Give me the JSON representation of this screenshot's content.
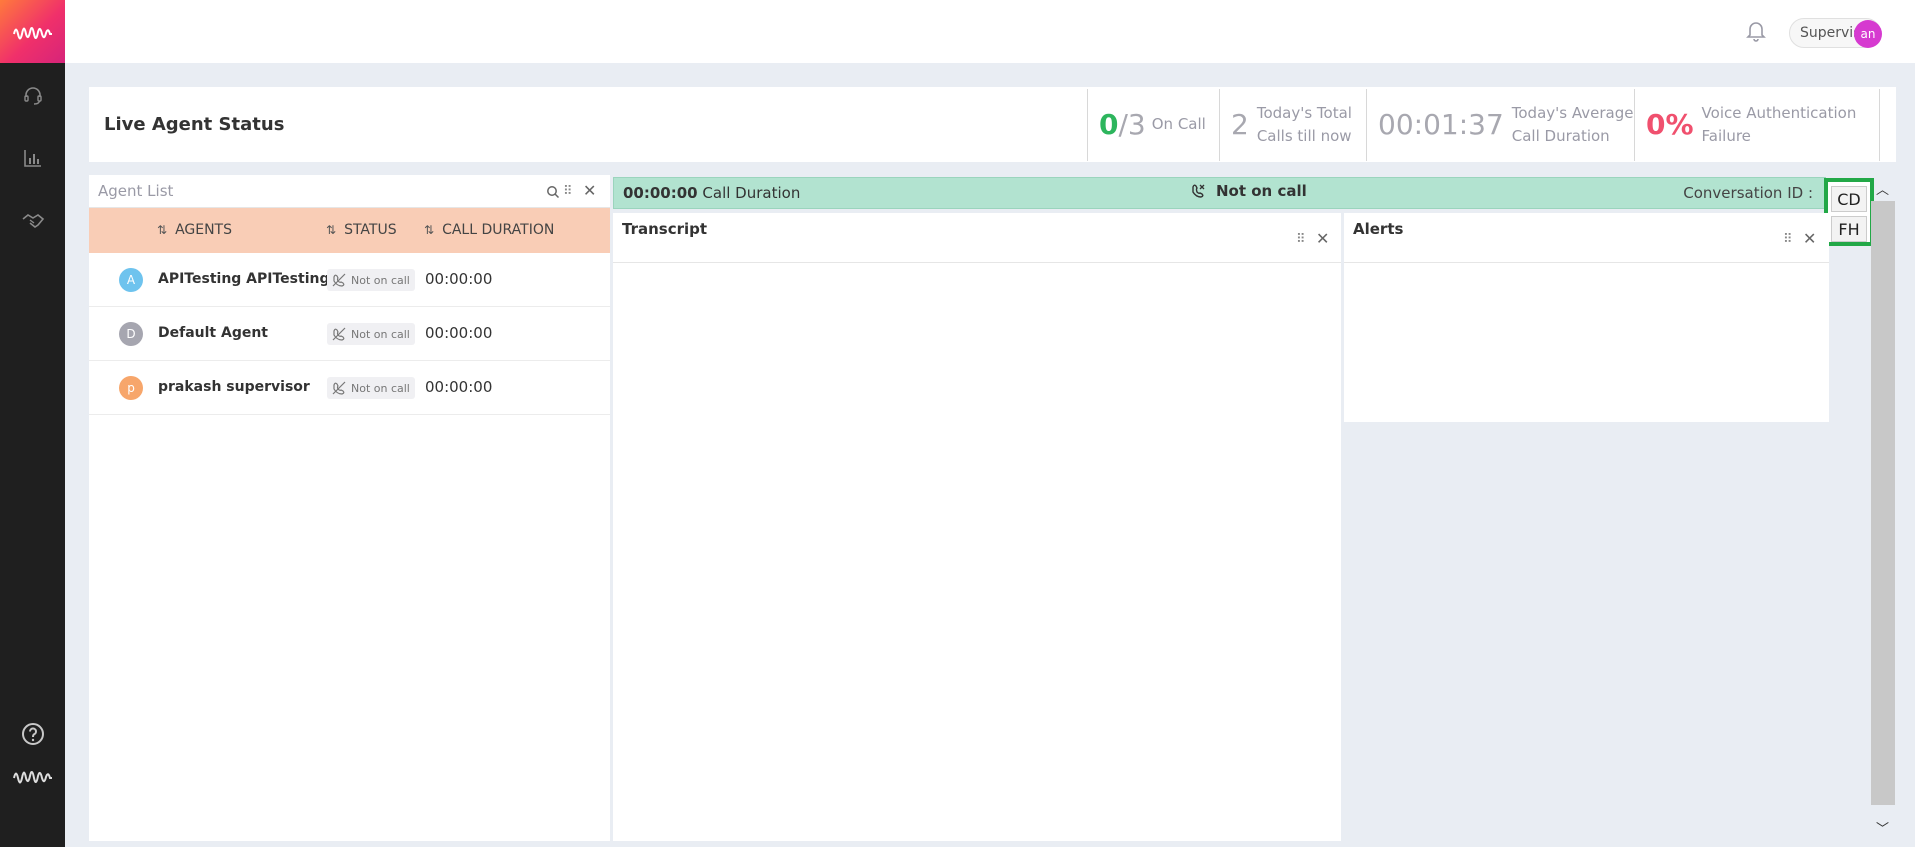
{
  "sidebar": {
    "items": [
      {
        "icon": "headset-icon"
      },
      {
        "icon": "bar-chart-icon"
      },
      {
        "icon": "handshake-icon"
      }
    ],
    "bottom": [
      {
        "icon": "help-icon"
      },
      {
        "icon": "wave-logo-icon"
      }
    ]
  },
  "topbar": {
    "role": "Supervisor",
    "avatar_initials": "an"
  },
  "header": {
    "title": "Live Agent Status",
    "metrics": {
      "on_call": {
        "count": "0",
        "total": "/3",
        "label": "On Call"
      },
      "total_calls": {
        "value": "2",
        "label_line1": "Today's Total",
        "label_line2": "Calls till now"
      },
      "avg_duration": {
        "value": "00:01:37",
        "label_line1": "Today's Average",
        "label_line2": "Call Duration"
      },
      "voice_auth": {
        "value": "0%",
        "label_line1": "Voice Authentication",
        "label_line2": "Failure"
      }
    }
  },
  "agent_list": {
    "placeholder": "Agent List",
    "columns": [
      "AGENTS",
      "STATUS",
      "CALL DURATION"
    ],
    "rows": [
      {
        "initial": "A",
        "name": "APITesting APITesting",
        "status": "Not on call",
        "duration": "00:00:00",
        "color": "#6ec3ee"
      },
      {
        "initial": "D",
        "name": "Default Agent",
        "status": "Not on call",
        "duration": "00:00:00",
        "color": "#a6a6b0"
      },
      {
        "initial": "p",
        "name": "prakash supervisor",
        "status": "Not on call",
        "duration": "00:00:00",
        "color": "#f7a66b"
      }
    ]
  },
  "call_bar": {
    "duration": "00:00:00",
    "duration_label": "Call Duration",
    "status": "Not on call",
    "conversation_label": "Conversation ID :"
  },
  "side_buttons": {
    "cd": "CD",
    "fh": "FH"
  },
  "transcript": {
    "title": "Transcript"
  },
  "alerts": {
    "title": "Alerts"
  },
  "colors": {
    "green": "#2db55d",
    "red": "#f0506e",
    "call_bar": "#b2e3d0",
    "agents_header": "#f9cdb6",
    "highlight_border": "#22a847"
  }
}
